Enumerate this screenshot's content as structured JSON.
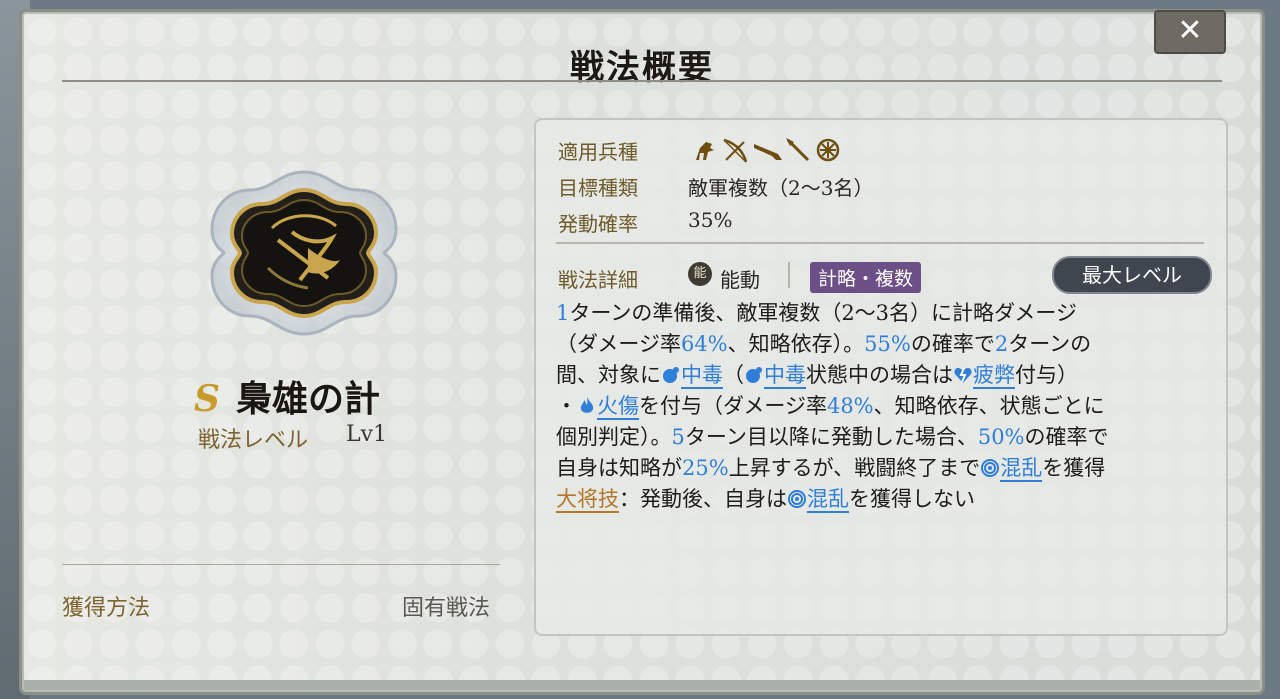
{
  "window": {
    "title": "戦法概要",
    "close_label": "✕"
  },
  "skill": {
    "grade": "S",
    "name": "梟雄の計",
    "level_label": "戦法レベル",
    "level_value": "Lv1",
    "acquisition_label": "獲得方法",
    "acquisition_value": "固有戦法"
  },
  "info": {
    "troop_label": "適用兵種",
    "troop_icons": [
      "cavalry-icon",
      "bow-icon",
      "gun-icon",
      "spear-icon",
      "chariot-icon"
    ],
    "target_label": "目標種類",
    "target_value": "敵軍複数（2〜3名）",
    "rate_label": "発動確率",
    "rate_value": "35%",
    "detail_label": "戦法詳細",
    "type_badge": "能",
    "type_value": "能動",
    "tag": "計略・複数",
    "max_level_button": "最大レベル"
  },
  "description": {
    "l1_n1": "1",
    "l1_t1": "ターンの準備後、敵軍複数（2〜3名）に計略ダメージ",
    "l2_t1": "（ダメージ率",
    "l2_n1": "64%",
    "l2_t2": "、知略依存）。",
    "l2_n2": "55%",
    "l2_t3": "の確率で",
    "l2_n3": "2",
    "l2_t4": "ターンの",
    "l3_t1": "間、対象に",
    "kw_poison": "中毒",
    "l3_t2": "（",
    "l3_t3": "状態中の場合は",
    "kw_fatigue": "疲弊",
    "l3_t4": "付与）",
    "l4_t1": "・",
    "kw_burn": "火傷",
    "l4_t2": "を付与（ダメージ率",
    "l4_n1": "48%",
    "l4_t3": "、知略依存、状態ごとに",
    "l5_t1": "個別判定）。",
    "l5_n1": "5",
    "l5_t2": "ターン目以降に発動した場合、",
    "l5_n2": "50%",
    "l5_t3": "の確率で",
    "l6_t1": "自身は知略が",
    "l6_n1": "25%",
    "l6_t2": "上昇するが、戦闘終了まで",
    "kw_confusion": "混乱",
    "l6_t3": "を獲得",
    "kw_general": "大将技",
    "l7_t1": "：発動後、自身は",
    "l7_t2": "を獲得しない"
  },
  "colors": {
    "accent_blue": "#2f7ed8",
    "gold": "#b4782a",
    "tag_purple": "#6b4f86"
  }
}
